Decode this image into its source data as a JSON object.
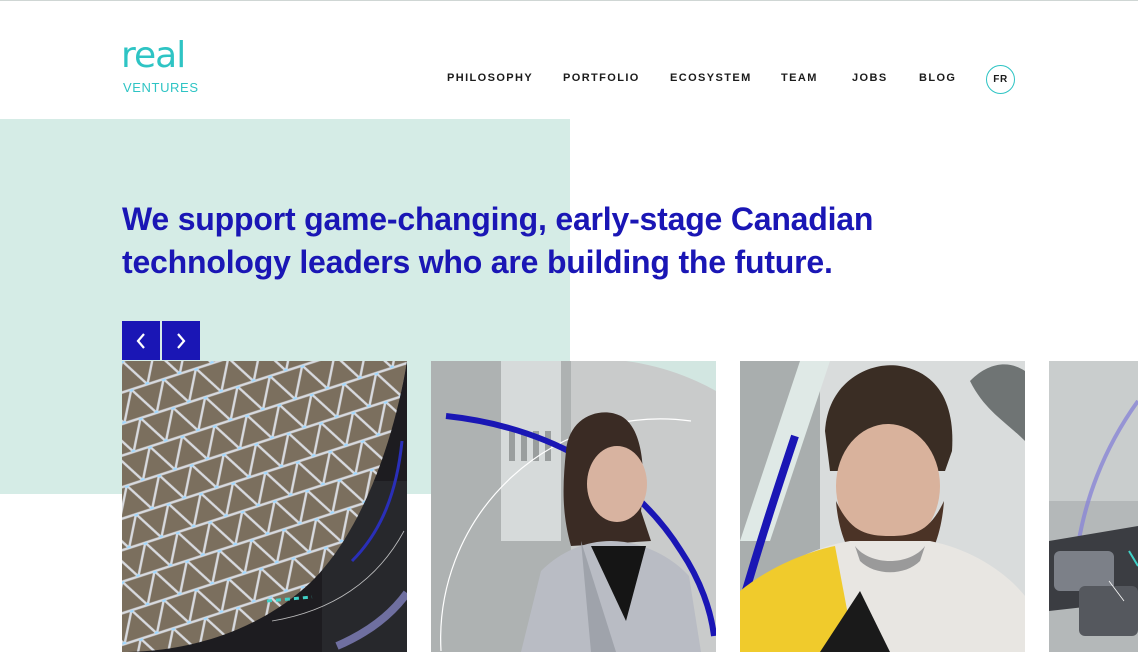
{
  "header": {
    "logo": {
      "word": "real",
      "sub": "VENTURES"
    },
    "nav": [
      {
        "id": "philosophy",
        "label": "PHILOSOPHY"
      },
      {
        "id": "portfolio",
        "label": "PORTFOLIO"
      },
      {
        "id": "ecosystem",
        "label": "ECOSYSTEM"
      },
      {
        "id": "team",
        "label": "TEAM"
      },
      {
        "id": "jobs",
        "label": "JOBS"
      },
      {
        "id": "blog",
        "label": "BLOG"
      }
    ],
    "lang": "FR"
  },
  "hero": {
    "headline_line1": "We support game-changing, early-stage Canadian",
    "headline_line2": "technology leaders who are building the future."
  },
  "carousel": {
    "prev_icon": "chevron-left-icon",
    "next_icon": "chevron-right-icon",
    "cards": [
      {
        "image": "architecture-dome-photo"
      },
      {
        "image": "woman-portrait-photo"
      },
      {
        "image": "bearded-man-portrait-photo"
      },
      {
        "image": "partial-card-photo"
      }
    ]
  },
  "colors": {
    "accent_blue": "#1a16b5",
    "teal": "#2ec4c4",
    "mint": "#d5ece6",
    "text": "#1b1b1b"
  }
}
